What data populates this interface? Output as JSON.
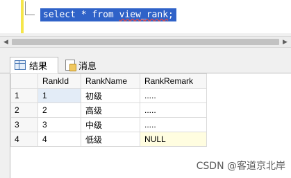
{
  "editor": {
    "sql_keyword_select": "select",
    "sql_star": "*",
    "sql_keyword_from": "from",
    "sql_object": "view_rank",
    "sql_end": ";"
  },
  "tabs": [
    {
      "label": "结果"
    },
    {
      "label": "消息"
    }
  ],
  "grid": {
    "columns": [
      "RankId",
      "RankName",
      "RankRemark"
    ],
    "rows": [
      {
        "num": "1",
        "id": "1",
        "name": "初级",
        "remark": "....."
      },
      {
        "num": "2",
        "id": "2",
        "name": "高级",
        "remark": "....."
      },
      {
        "num": "3",
        "id": "3",
        "name": "中级",
        "remark": "....."
      },
      {
        "num": "4",
        "id": "4",
        "name": "低级",
        "remark": "NULL"
      }
    ]
  },
  "watermark": "CSDN @客道京北岸",
  "colors": {
    "selection": "#2f62c8",
    "gutter_marker": "#f5e64a",
    "null_cell": "#fffde0"
  }
}
